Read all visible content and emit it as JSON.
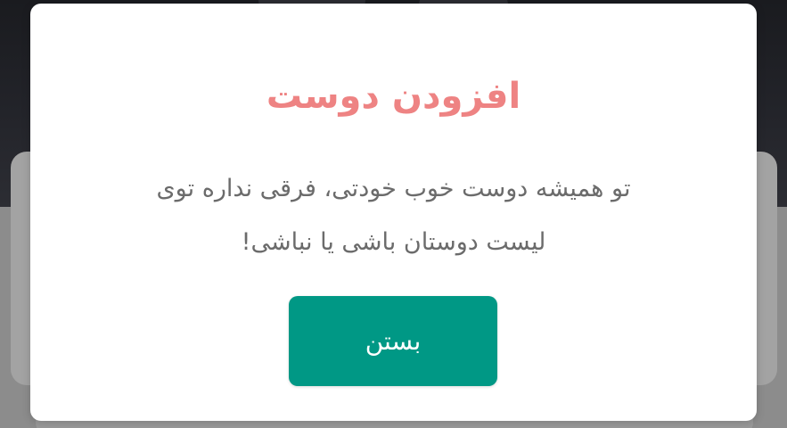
{
  "dialog": {
    "title": "افزودن دوست",
    "message_line1": "تو همیشه دوست خوب خودتی، فرقی نداره توی",
    "message_line2": "لیست دوستان باشی یا نباشی!",
    "close_label": "بستن"
  },
  "colors": {
    "title": "#ee8383",
    "button": "#009885",
    "overlay": "#8a8a8a"
  }
}
